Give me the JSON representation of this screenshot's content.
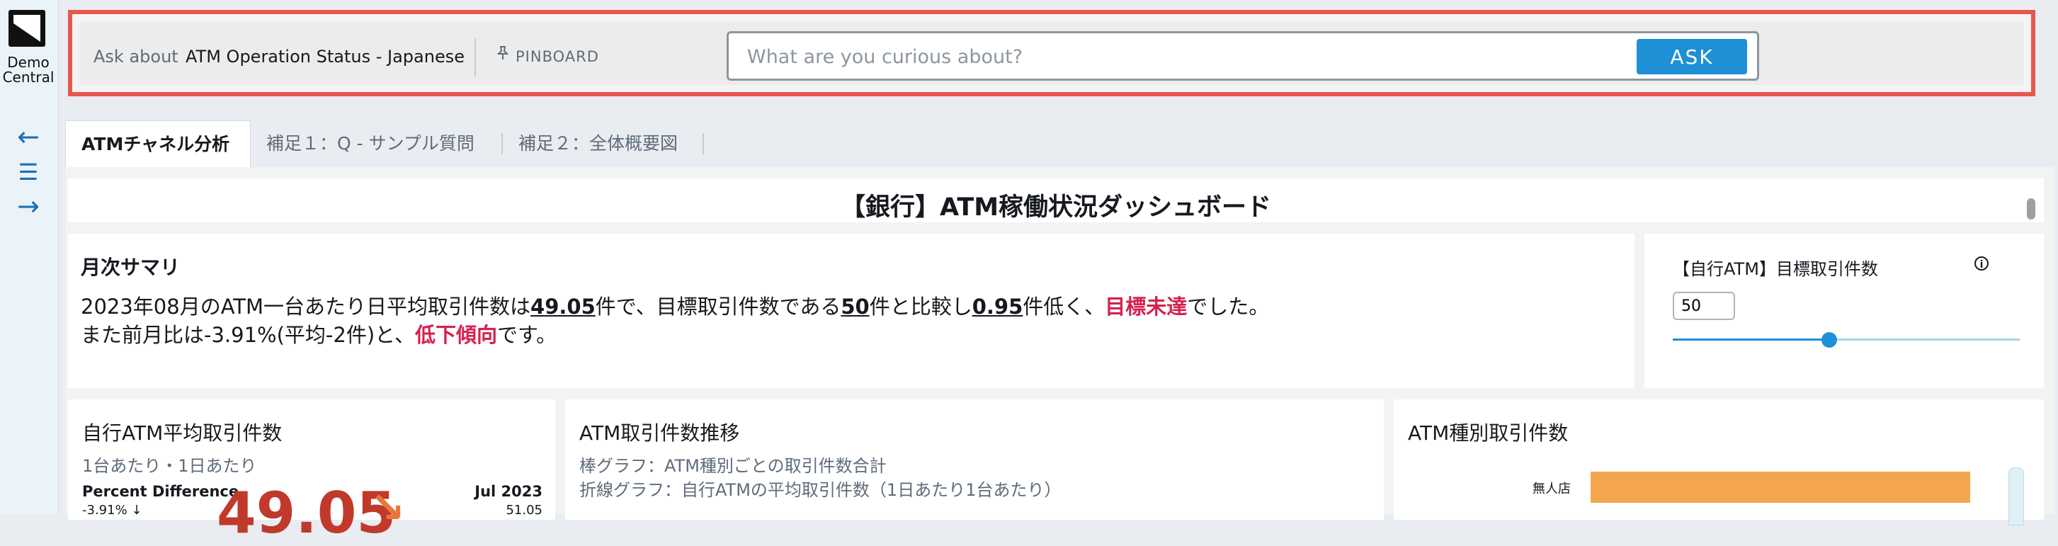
{
  "app": {
    "logo_text_line1": "Demo",
    "logo_text_line2": "Central"
  },
  "rail": {
    "back_icon": "←",
    "menu_icon": "☰",
    "forward_icon": "→"
  },
  "askbar": {
    "ask_about_label": "Ask about",
    "topic": "ATM Operation Status - Japanese",
    "pin_icon": "📌",
    "pinboard_label": "PINBOARD",
    "search_placeholder": "What are you curious about?",
    "ask_button": "ASK",
    "highlight_color": "#e8574e"
  },
  "tabs": [
    {
      "label": "ATMチャネル分析",
      "active": true
    },
    {
      "label": "補足１：Q - サンプル質問",
      "active": false
    },
    {
      "label": "補足２：全体概要図",
      "active": false
    }
  ],
  "dashboard": {
    "title": "【銀行】ATM稼働状況ダッシュボード",
    "summary": {
      "title": "月次サマリ",
      "line1_prefix": "2023年08月のATM一台あたり日平均取引件数は",
      "line1_value1": "49.05",
      "line1_mid1": "件で、目標取引件数である",
      "line1_value2": "50",
      "line1_mid2": "件と比較し",
      "line1_value3": "0.95",
      "line1_mid3": "件低く、",
      "line1_status": "目標未達",
      "line1_suffix": "でした。",
      "line2_prefix": "また前月比は-3.91%(平均-2件)と、",
      "line2_status": "低下傾向",
      "line2_suffix": "です。"
    },
    "parameter": {
      "title": "【自行ATM】目標取引件数",
      "info_icon": "i",
      "value": "50",
      "slider_fraction": 0.45
    },
    "kpi": {
      "title": "自行ATM平均取引件数",
      "subtitle": "1台あたり・1日あたり",
      "pd_label": "Percent Difference",
      "pd_value": "-3.91% ↓",
      "value": "49.05",
      "arrow": "↘",
      "period_label": "Jul 2023",
      "period_value": "51.05"
    },
    "trend": {
      "title": "ATM取引件数推移",
      "note1": "棒グラフ：ATM種別ごとの取引件数合計",
      "note2": "折線グラフ：自行ATMの平均取引件数（1日あたり1台あたり）"
    },
    "by_type": {
      "title": "ATM種別取引件数",
      "bar_label": "無人店",
      "bar_color": "#f3a64e"
    }
  }
}
